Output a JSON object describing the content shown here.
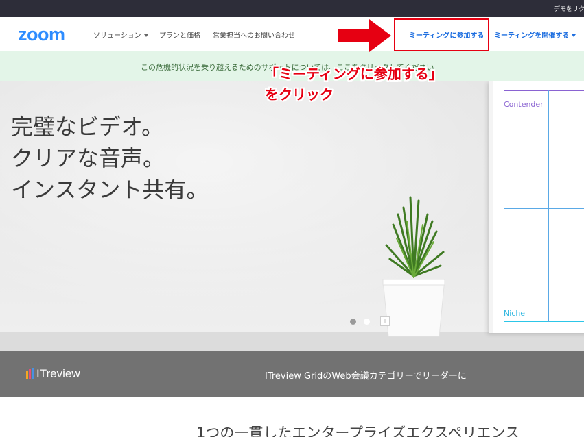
{
  "topbar": {
    "demo_label": "デモをリクエ"
  },
  "header": {
    "logo": "zoom",
    "nav_left": [
      "ソリューション",
      "プランと価格",
      "営業担当へのお問い合わせ"
    ],
    "nav_right": [
      "ミーティングに参加する",
      "ミーティングを開催する"
    ]
  },
  "banner": {
    "text": "この危機的状況を乗り越えるためのサポートについては、ここをクリックしてください"
  },
  "hero": {
    "lines": [
      "完璧なビデオ。",
      "クリアな音声。",
      "インスタント共有。"
    ],
    "board_labels": {
      "top": "Contender",
      "bottom": "Niche"
    },
    "pause_symbol": "II"
  },
  "itstrip": {
    "logo": "ITreview",
    "text": "ITreview GridのWeb会議カテゴリーでリーダーに"
  },
  "section": {
    "heading": "1つの一貫したエンタープライズエクスペリエンス"
  },
  "annotation": {
    "line1": "「ミーティングに参加する」",
    "line2": "をクリック"
  },
  "colors": {
    "zoom_blue": "#2d8cff",
    "annotation_red": "#e60012",
    "banner_green": "#e3f5e8"
  }
}
